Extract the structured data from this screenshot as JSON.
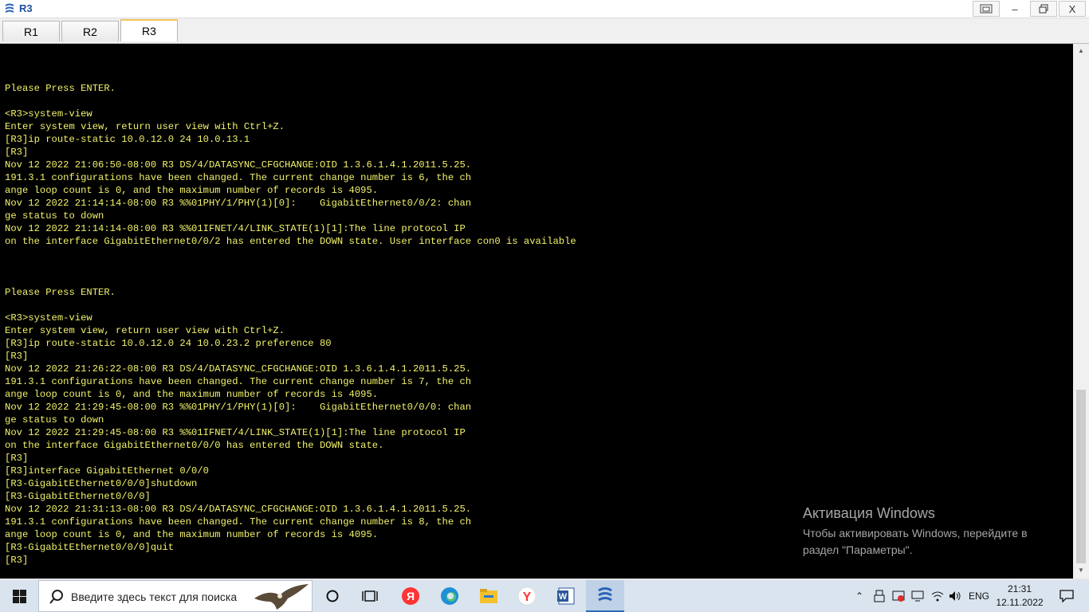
{
  "window": {
    "title": "R3",
    "controls": {
      "restore_down_label": "🗗",
      "minimize_label": "–",
      "maximize_label": "🗗",
      "close_label": "X"
    }
  },
  "tabs": [
    {
      "label": "R1",
      "active": false
    },
    {
      "label": "R2",
      "active": false
    },
    {
      "label": "R3",
      "active": true
    }
  ],
  "terminal": {
    "text_color": "#f2f26a",
    "background": "#000000",
    "lines": [
      "Please Press ENTER.",
      "",
      "<R3>system-view",
      "Enter system view, return user view with Ctrl+Z.",
      "[R3]ip route-static 10.0.12.0 24 10.0.13.1",
      "[R3]",
      "Nov 12 2022 21:06:50-08:00 R3 DS/4/DATASYNC_CFGCHANGE:OID 1.3.6.1.4.1.2011.5.25.",
      "191.3.1 configurations have been changed. The current change number is 6, the ch",
      "ange loop count is 0, and the maximum number of records is 4095.",
      "Nov 12 2022 21:14:14-08:00 R3 %%01PHY/1/PHY(1)[0]:    GigabitEthernet0/0/2: chan",
      "ge status to down",
      "Nov 12 2022 21:14:14-08:00 R3 %%01IFNET/4/LINK_STATE(1)[1]:The line protocol IP",
      "on the interface GigabitEthernet0/0/2 has entered the DOWN state. User interface con0 is available",
      "",
      "",
      "",
      "Please Press ENTER.",
      "",
      "<R3>system-view",
      "Enter system view, return user view with Ctrl+Z.",
      "[R3]ip route-static 10.0.12.0 24 10.0.23.2 preference 80",
      "[R3]",
      "Nov 12 2022 21:26:22-08:00 R3 DS/4/DATASYNC_CFGCHANGE:OID 1.3.6.1.4.1.2011.5.25.",
      "191.3.1 configurations have been changed. The current change number is 7, the ch",
      "ange loop count is 0, and the maximum number of records is 4095.",
      "Nov 12 2022 21:29:45-08:00 R3 %%01PHY/1/PHY(1)[0]:    GigabitEthernet0/0/0: chan",
      "ge status to down",
      "Nov 12 2022 21:29:45-08:00 R3 %%01IFNET/4/LINK_STATE(1)[1]:The line protocol IP",
      "on the interface GigabitEthernet0/0/0 has entered the DOWN state.",
      "[R3]",
      "[R3]interface GigabitEthernet 0/0/0",
      "[R3-GigabitEthernet0/0/0]shutdown",
      "[R3-GigabitEthernet0/0/0]",
      "Nov 12 2022 21:31:13-08:00 R3 DS/4/DATASYNC_CFGCHANGE:OID 1.3.6.1.4.1.2011.5.25.",
      "191.3.1 configurations have been changed. The current change number is 8, the ch",
      "ange loop count is 0, and the maximum number of records is 4095.",
      "[R3-GigabitEthernet0/0/0]quit",
      "[R3]"
    ]
  },
  "activation": {
    "title": "Активация Windows",
    "line1": "Чтобы активировать Windows, перейдите в",
    "line2": "раздел \"Параметры\"."
  },
  "taskbar": {
    "search_placeholder": "Введите здесь текст для поиска",
    "icons": [
      "windows-start-icon",
      "search-icon",
      "task-view-icon",
      "widgets-icon",
      "yandex-icon",
      "edge-icon",
      "file-explorer-icon",
      "yandex-browser-icon",
      "word-icon",
      "ensp-icon"
    ],
    "tray": {
      "language": "ENG",
      "time": "21:31",
      "date": "12.11.2022"
    }
  }
}
